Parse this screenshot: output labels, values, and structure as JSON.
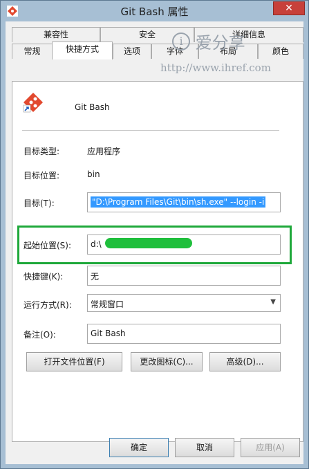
{
  "window": {
    "title": "Git Bash 属性"
  },
  "tabs_row1": [
    "兼容性",
    "安全",
    "详细信息"
  ],
  "tabs_row2": [
    "常规",
    "快捷方式",
    "选项",
    "字体",
    "布局",
    "颜色"
  ],
  "header": {
    "name": "Git Bash"
  },
  "fields": {
    "target_type": {
      "label": "目标类型:",
      "value": "应用程序"
    },
    "target_location": {
      "label": "目标位置:",
      "value": "bin"
    },
    "target": {
      "label": "目标(T):",
      "value": "\"D:\\Program Files\\Git\\bin\\sh.exe\" --login -i"
    },
    "start_in": {
      "label": "起始位置(S):",
      "value": "d:\\"
    },
    "shortcut_key": {
      "label": "快捷键(K):",
      "value": "无"
    },
    "run": {
      "label": "运行方式(R):",
      "value": "常规窗口"
    },
    "comment": {
      "label": "备注(O):",
      "value": "Git Bash"
    }
  },
  "action_buttons": {
    "open_location": "打开文件位置(F)",
    "change_icon": "更改图标(C)...",
    "advanced": "高级(D)..."
  },
  "dialog_buttons": {
    "ok": "确定",
    "cancel": "取消",
    "apply": "应用(A)"
  },
  "watermark": {
    "site": "爱分享",
    "url": "http://www.ihref.com"
  },
  "colors": {
    "highlight": "#1ea83a",
    "selection": "#3399ff",
    "frame": "#a7bfd4"
  }
}
